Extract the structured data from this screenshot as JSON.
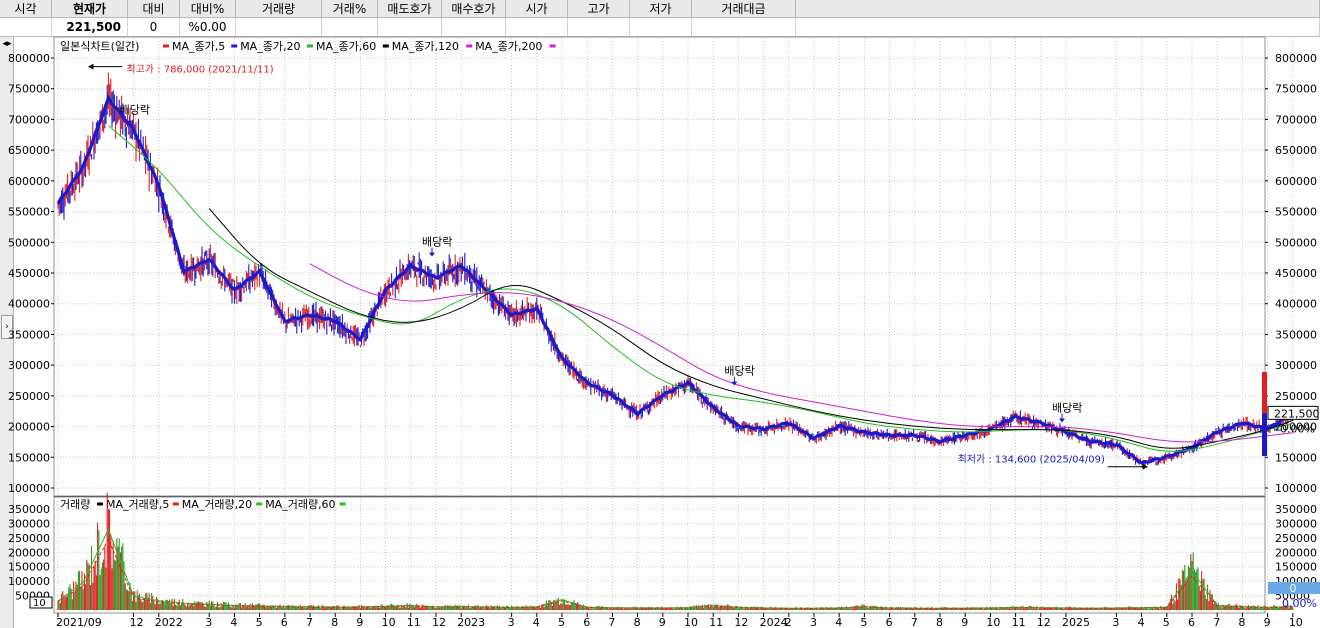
{
  "header": {
    "columns": [
      "시각",
      "현재가",
      "대비",
      "대비%",
      "거래량",
      "거래%",
      "매도호가",
      "매수호가",
      "시가",
      "고가",
      "저가",
      "거래대금"
    ],
    "values": [
      "",
      "221,500",
      "0",
      "%0.00",
      "",
      "",
      "",
      "",
      "",
      "",
      "",
      ""
    ]
  },
  "left_controls": {
    "top_icon": "arrows-left-right-icon",
    "mid_icon": "chevron-right-icon"
  },
  "price_legend": {
    "chart_name": "일본식차트(일간)",
    "items": [
      {
        "label": "MA_종가,5",
        "color": "#e02020"
      },
      {
        "label": "MA_종가,20",
        "color": "#1a1acc"
      },
      {
        "label": "MA_종가,60",
        "color": "#20c020"
      },
      {
        "label": "MA_종가,120",
        "color": "#000000"
      },
      {
        "label": "MA_종가,200",
        "color": "#d020d0"
      }
    ]
  },
  "volume_legend": {
    "chart_name": "거래량",
    "items": [
      {
        "label": "MA_거래량,5",
        "color": "#000000"
      },
      {
        "label": "MA_거래량,20",
        "color": "#e02020"
      },
      {
        "label": "MA_거래량,60",
        "color": "#20c020"
      }
    ]
  },
  "annotations": {
    "high": "최고가 : 786,000 (2021/11/11)",
    "low": "최저가 : 134,600 (2025/04/09)",
    "dividend": "배당락"
  },
  "current_price": {
    "label": "221,500",
    "change_pct": "0.00%"
  },
  "volume_current": {
    "label": "0",
    "change_pct": "0.00%"
  },
  "volume_edge_tick": "10",
  "chart_data": [
    {
      "type": "line",
      "title": "일본식차트(일간)",
      "ylim": [
        100000,
        800000
      ],
      "y_ticks": [
        100000,
        150000,
        200000,
        250000,
        300000,
        350000,
        400000,
        450000,
        500000,
        550000,
        600000,
        650000,
        700000,
        750000,
        800000
      ],
      "x_ticks": [
        "2021/09",
        "12",
        "2022",
        "3",
        "4",
        "5",
        "6",
        "7",
        "8",
        "9",
        "10",
        "11",
        "12",
        "2023",
        "3",
        "4",
        "5",
        "6",
        "7",
        "8",
        "9",
        "10",
        "11",
        "12",
        "2024",
        "2",
        "3",
        "4",
        "5",
        "6",
        "7",
        "8",
        "9",
        "10",
        "11",
        "12",
        "2025",
        "3",
        "4",
        "5",
        "6",
        "7",
        "8",
        "9",
        "10"
      ],
      "series": [
        {
          "name": "종가",
          "color": "#e02020",
          "x": [
            "2021/09",
            "2021/10",
            "2021/11",
            "2021/12",
            "2022/01",
            "2022/02",
            "2022/03",
            "2022/04",
            "2022/05",
            "2022/06",
            "2022/07",
            "2022/08",
            "2022/09",
            "2022/10",
            "2022/11",
            "2022/12",
            "2023/01",
            "2023/02",
            "2023/03",
            "2023/04",
            "2023/05",
            "2023/06",
            "2023/07",
            "2023/08",
            "2023/09",
            "2023/10",
            "2023/11",
            "2023/12",
            "2024/01",
            "2024/02",
            "2024/03",
            "2024/04",
            "2024/05",
            "2024/06",
            "2024/07",
            "2024/08",
            "2024/09",
            "2024/10",
            "2024/11",
            "2024/12",
            "2025/01",
            "2025/02",
            "2025/03",
            "2025/04",
            "2025/05",
            "2025/06",
            "2025/07",
            "2025/08",
            "2025/09",
            "2025/10"
          ],
          "values": [
            560000,
            620000,
            730000,
            680000,
            590000,
            450000,
            470000,
            420000,
            450000,
            370000,
            380000,
            370000,
            340000,
            420000,
            460000,
            440000,
            460000,
            420000,
            380000,
            390000,
            310000,
            270000,
            250000,
            220000,
            250000,
            270000,
            230000,
            200000,
            195000,
            205000,
            180000,
            200000,
            190000,
            185000,
            185000,
            175000,
            185000,
            195000,
            215000,
            205000,
            190000,
            175000,
            170000,
            140000,
            150000,
            165000,
            190000,
            205000,
            195000,
            221500
          ]
        },
        {
          "name": "MA_종가,60",
          "color": "#20c020",
          "x": [
            "2021/11",
            "2022/01",
            "2022/03",
            "2022/05",
            "2022/07",
            "2022/09",
            "2022/11",
            "2023/01",
            "2023/03",
            "2023/05",
            "2023/07",
            "2023/09",
            "2023/11",
            "2024/01",
            "2024/03",
            "2024/05",
            "2024/07",
            "2024/09",
            "2024/11",
            "2025/01",
            "2025/03",
            "2025/05",
            "2025/07",
            "2025/09",
            "2025/10"
          ],
          "values": [
            690000,
            620000,
            520000,
            460000,
            410000,
            380000,
            360000,
            410000,
            430000,
            400000,
            330000,
            270000,
            250000,
            240000,
            225000,
            205000,
            195000,
            190000,
            195000,
            195000,
            180000,
            155000,
            170000,
            195000,
            205000
          ]
        },
        {
          "name": "MA_종가,120",
          "color": "#000000",
          "x": [
            "2022/03",
            "2022/05",
            "2022/07",
            "2022/09",
            "2022/11",
            "2023/01",
            "2023/03",
            "2023/05",
            "2023/07",
            "2023/09",
            "2023/11",
            "2024/01",
            "2024/03",
            "2024/05",
            "2024/07",
            "2024/09",
            "2024/11",
            "2025/01",
            "2025/03",
            "2025/05",
            "2025/07",
            "2025/09",
            "2025/10"
          ],
          "values": [
            555000,
            460000,
            420000,
            380000,
            365000,
            390000,
            440000,
            405000,
            360000,
            300000,
            265000,
            245000,
            225000,
            210000,
            200000,
            195000,
            195000,
            195000,
            185000,
            160000,
            175000,
            195000,
            210000
          ]
        },
        {
          "name": "MA_종가,200",
          "color": "#d020d0",
          "x": [
            "2022/07",
            "2022/09",
            "2022/11",
            "2023/01",
            "2023/03",
            "2023/05",
            "2023/07",
            "2023/09",
            "2023/11",
            "2024/01",
            "2024/03",
            "2024/05",
            "2024/07",
            "2024/09",
            "2024/11",
            "2025/01",
            "2025/03",
            "2025/05",
            "2025/07",
            "2025/09",
            "2025/10"
          ],
          "values": [
            465000,
            420000,
            400000,
            415000,
            420000,
            405000,
            375000,
            330000,
            280000,
            255000,
            240000,
            225000,
            210000,
            200000,
            200000,
            200000,
            190000,
            175000,
            175000,
            185000,
            190000
          ]
        }
      ]
    },
    {
      "type": "bar",
      "title": "거래량",
      "ylim": [
        0,
        380000
      ],
      "y_ticks": [
        0,
        50000,
        100000,
        150000,
        200000,
        250000,
        300000,
        350000
      ],
      "categories": [
        "2021/09",
        "2021/10",
        "2021/11",
        "2021/12",
        "2022/01",
        "2022/02",
        "2022/03",
        "2022/04",
        "2022/05",
        "2022/06",
        "2022/07",
        "2022/08",
        "2022/09",
        "2022/10",
        "2022/11",
        "2022/12",
        "2023/01",
        "2023/02",
        "2023/03",
        "2023/04",
        "2023/05",
        "2023/06",
        "2023/07",
        "2023/08",
        "2023/09",
        "2023/10",
        "2023/11",
        "2023/12",
        "2024/01",
        "2024/02",
        "2024/03",
        "2024/04",
        "2024/05",
        "2024/06",
        "2024/07",
        "2024/08",
        "2024/09",
        "2024/10",
        "2024/11",
        "2024/12",
        "2025/01",
        "2025/02",
        "2025/03",
        "2025/04",
        "2025/05",
        "2025/06",
        "2025/07",
        "2025/08",
        "2025/09",
        "2025/10"
      ],
      "values": [
        40000,
        120000,
        350000,
        60000,
        40000,
        30000,
        25000,
        20000,
        18000,
        15000,
        14000,
        12000,
        14000,
        16000,
        20000,
        14000,
        15000,
        14000,
        12000,
        14000,
        45000,
        12000,
        10000,
        9000,
        9000,
        10000,
        20000,
        12000,
        9000,
        8000,
        8000,
        9000,
        15000,
        9000,
        8000,
        8000,
        8000,
        9000,
        12000,
        10000,
        9000,
        8000,
        9000,
        10000,
        12000,
        170000,
        20000,
        15000,
        12000,
        15000
      ]
    }
  ]
}
